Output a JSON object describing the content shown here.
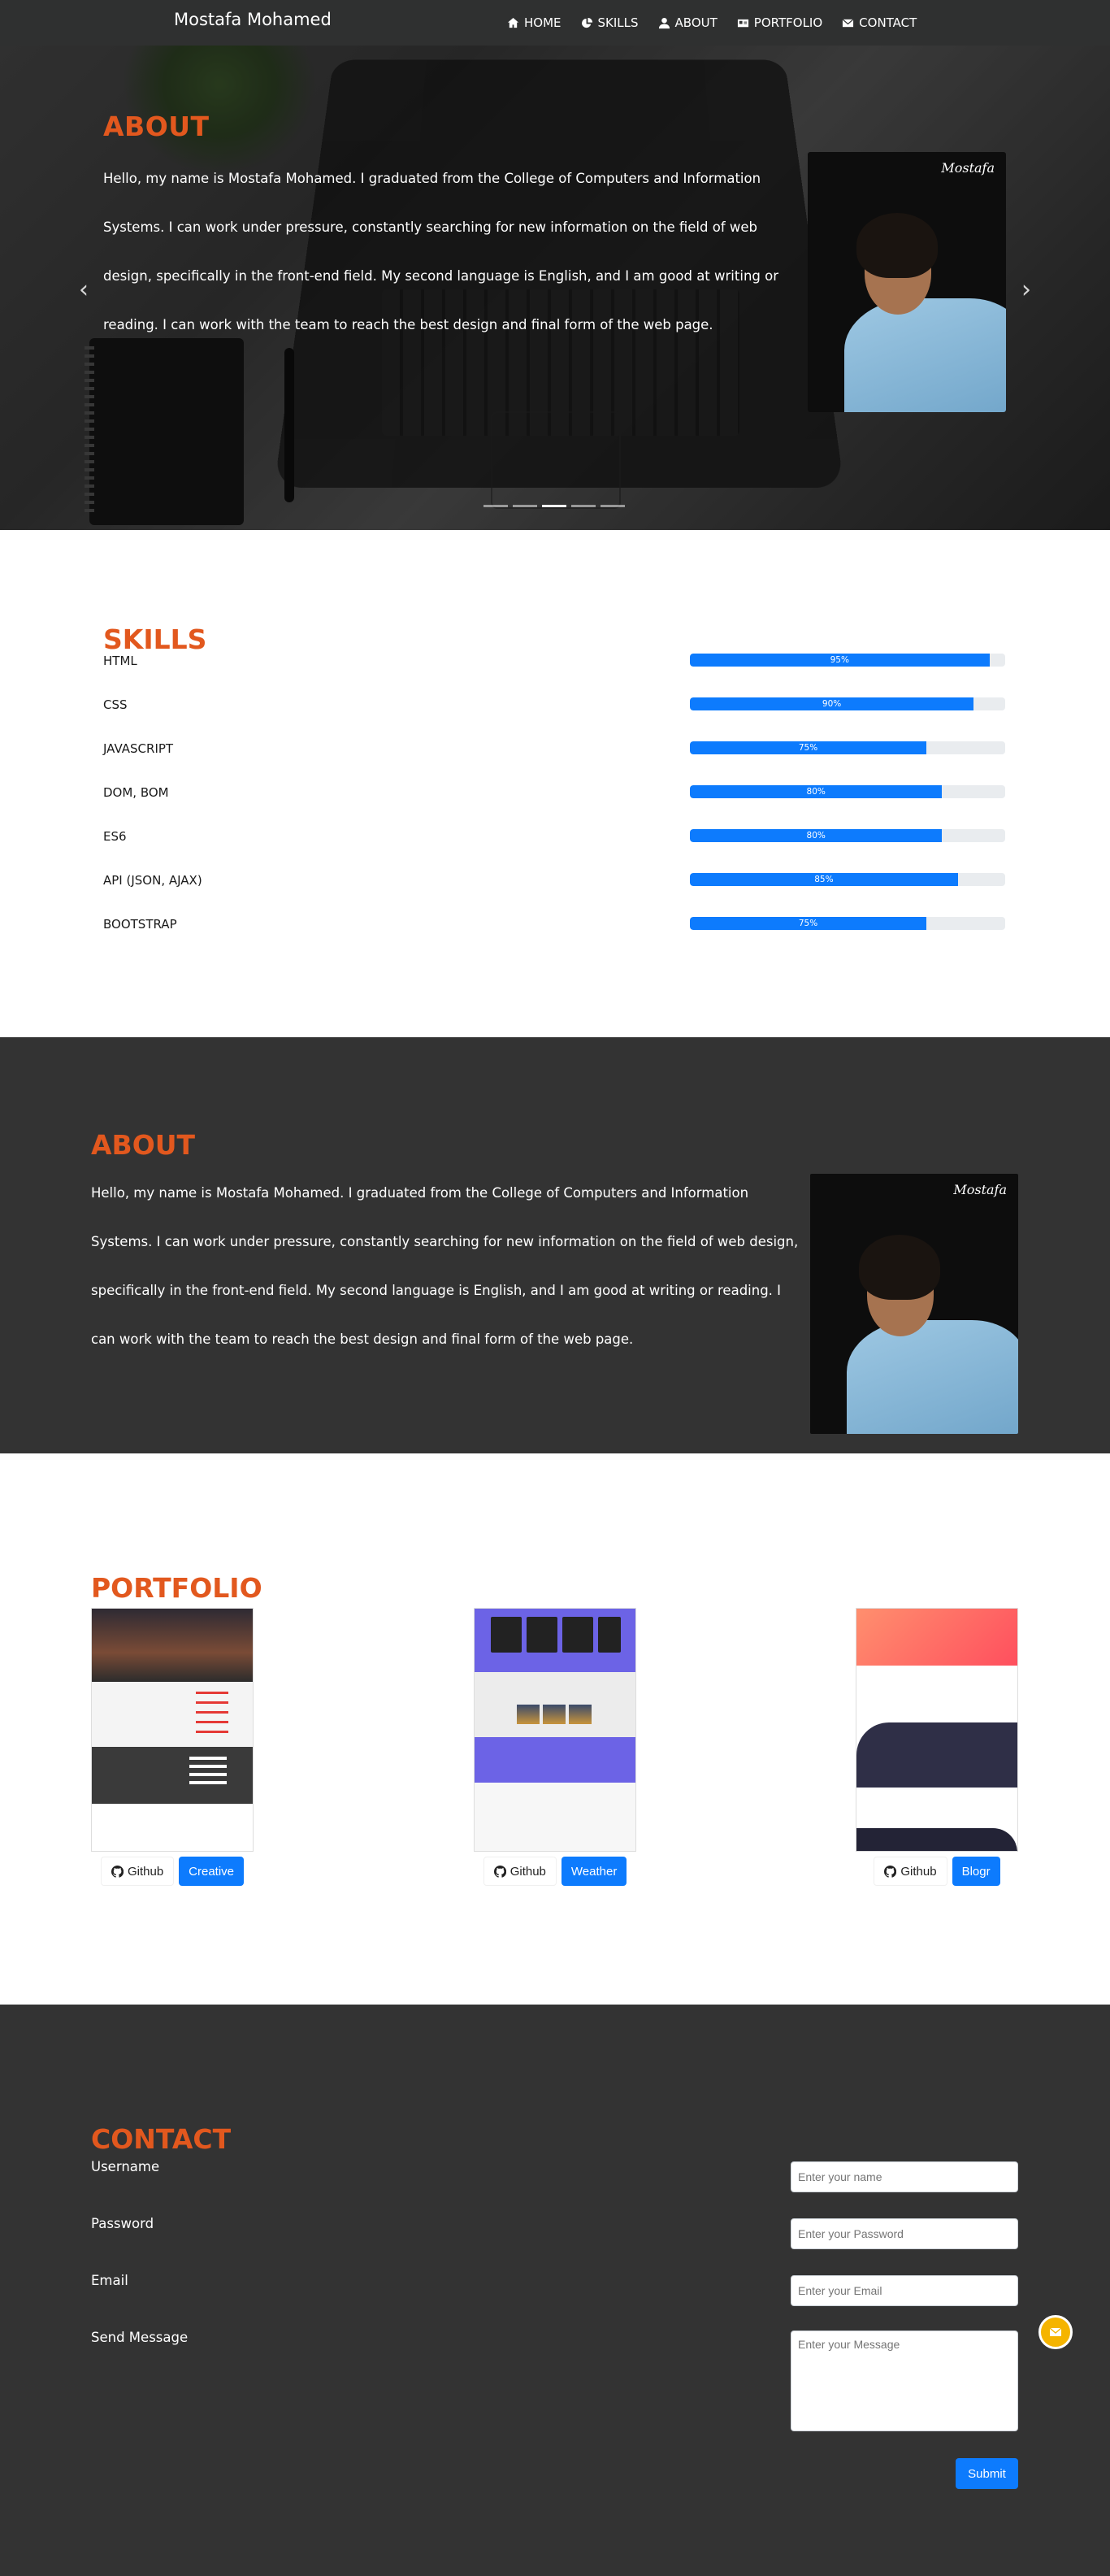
{
  "navbar": {
    "brand": "Mostafa Mohamed",
    "links": [
      {
        "label": "HOME",
        "icon": "home-icon"
      },
      {
        "label": "SKILLS",
        "icon": "pie-chart-icon"
      },
      {
        "label": "ABOUT",
        "icon": "user-icon"
      },
      {
        "label": "PORTFOLIO",
        "icon": "id-card-icon"
      },
      {
        "label": "CONTACT",
        "icon": "envelope-icon"
      }
    ]
  },
  "hero": {
    "title": "ABOUT",
    "text": "Hello, my name is Mostafa Mohamed. I graduated from the College of Computers and Information Systems. I can work under pressure, constantly searching for new information on the field of web design, specifically in the front-end field. My second language is English, and I am good at writing or reading. I can work with the team to reach the best design and final form of the web page.",
    "photo_signature": "Mostafa",
    "active_slide": 3,
    "slide_count": 5
  },
  "skills": {
    "title": "SKILLS",
    "items": [
      {
        "name": "HTML",
        "percent": 95,
        "label": "95%"
      },
      {
        "name": "CSS",
        "percent": 90,
        "label": "90%"
      },
      {
        "name": "JAVASCRIPT",
        "percent": 75,
        "label": "75%"
      },
      {
        "name": "DOM, BOM",
        "percent": 80,
        "label": "80%"
      },
      {
        "name": "ES6",
        "percent": 80,
        "label": "80%"
      },
      {
        "name": "API (JSON, AJAX)",
        "percent": 85,
        "label": "85%"
      },
      {
        "name": "BOOTSTRAP",
        "percent": 75,
        "label": "75%"
      }
    ]
  },
  "about": {
    "title": "ABOUT",
    "text": "Hello, my name is Mostafa Mohamed. I graduated from the College of Computers and Information Systems. I can work under pressure, constantly searching for new information on the field of web design, specifically in the front-end field. My second language is English, and I am good at writing or reading. I can work with the team to reach the best design and final form of the web page.",
    "photo_signature": "Mostafa"
  },
  "portfolio": {
    "title": "PORTFOLIO",
    "cards": [
      {
        "github_label": "Github",
        "demo_label": "Creative"
      },
      {
        "github_label": "Github",
        "demo_label": "Weather"
      },
      {
        "github_label": "Github",
        "demo_label": "Blogr"
      }
    ]
  },
  "contact": {
    "title": "CONTACT",
    "labels": {
      "username": "Username",
      "password": "Password",
      "email": "Email",
      "message": "Send Message"
    },
    "placeholders": {
      "name": "Enter your name",
      "password": "Enter your Password",
      "email": "Enter your Email",
      "message": "Enter your Message"
    },
    "submit_label": "Submit"
  },
  "colors": {
    "accent": "#e2581e",
    "primary": "#0d7bfd",
    "dark_bg": "#333333",
    "fab": "#f5b400"
  }
}
